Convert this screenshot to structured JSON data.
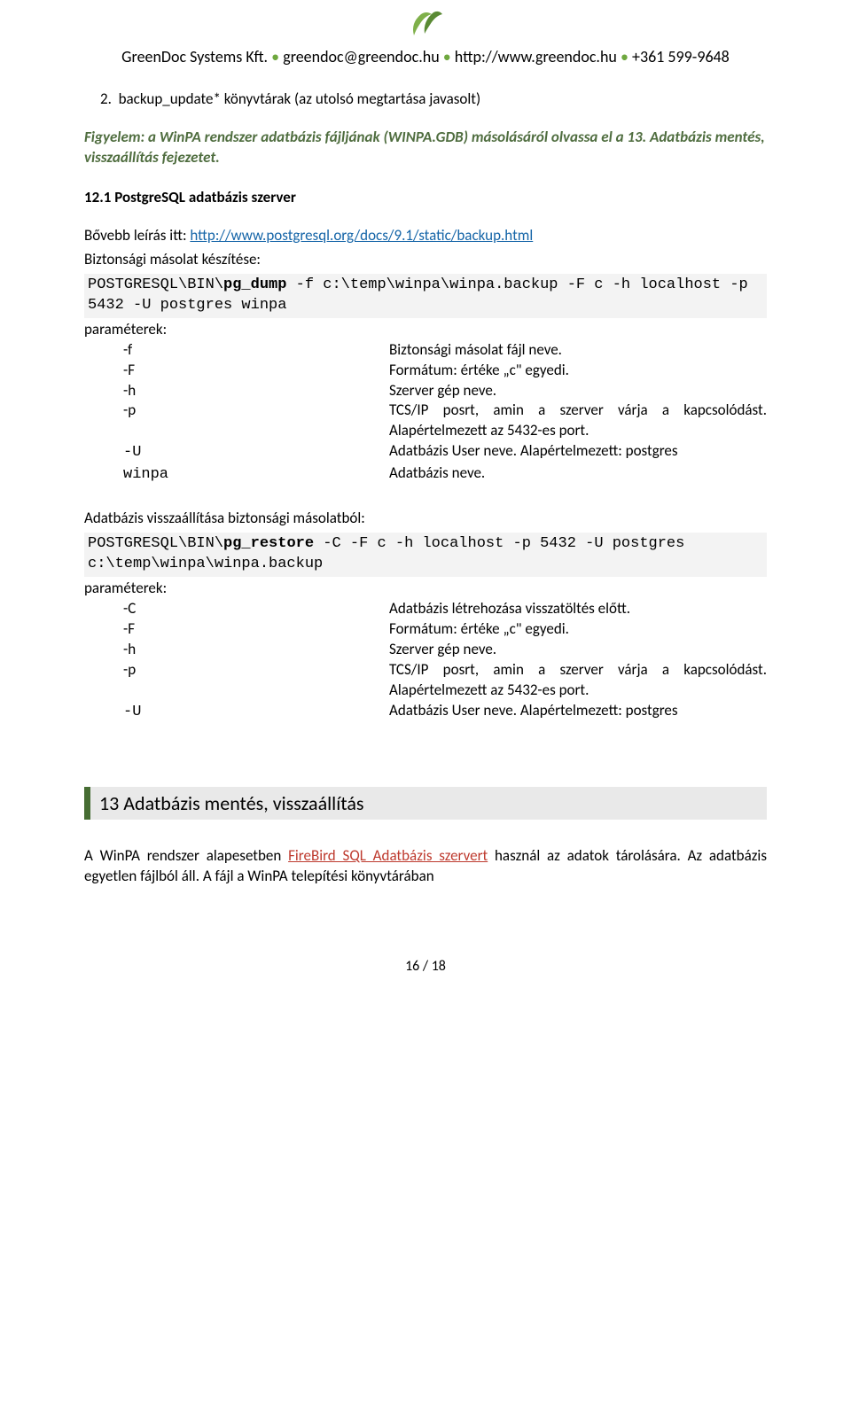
{
  "header": {
    "company": "GreenDoc Systems Kft.",
    "email": "greendoc@greendoc.hu",
    "url": "http://www.greendoc.hu",
    "phone": "+361 599-9648"
  },
  "item2": {
    "num": "2.",
    "text": "backup_update* könyvtárak (az utolsó megtartása javasolt)"
  },
  "notice": "Figyelem: a WinPA rendszer adatbázis fájljának (WINPA.GDB) másolásáról olvassa el a 13. Adatbázis mentés, visszaállítás fejezetet.",
  "subheading": "12.1 PostgreSQL adatbázis szerver",
  "detail_prefix": "Bővebb leírás itt: ",
  "detail_link": "http://www.postgresql.org/docs/9.1/static/backup.html",
  "backup_intro": "Biztonsági másolat készítése:",
  "code1_pre": "POSTGRESQL\\BIN\\",
  "code1_cmd": "pg_dump",
  "code1_post": " -f c:\\temp\\winpa\\winpa.backup -F c -h localhost -p 5432 -U postgres winpa",
  "params_label": "paraméterek:",
  "params1": [
    {
      "key": "-f",
      "mono": false,
      "desc": "Biztonsági másolat fájl neve."
    },
    {
      "key": "-F",
      "mono": false,
      "desc": "Formátum: értéke „c\" egyedi."
    },
    {
      "key": "-h",
      "mono": false,
      "desc": "Szerver gép neve."
    },
    {
      "key": "-p",
      "mono": false,
      "desc": "TCS/IP posrt, amin a szerver várja a kapcsolódást. Alapértelmezett az 5432-es port."
    },
    {
      "key": "-U",
      "mono": true,
      "desc": "Adatbázis User neve. Alapértelmezett: postgres"
    },
    {
      "key": "winpa",
      "mono": true,
      "desc": "Adatbázis neve."
    }
  ],
  "restore_intro": "Adatbázis visszaállítása biztonsági másolatból:",
  "code2_pre": "POSTGRESQL\\BIN\\",
  "code2_cmd": "pg_restore",
  "code2_post": " -C -F c -h localhost -p 5432 -U postgres c:\\temp\\winpa\\winpa.backup",
  "params2": [
    {
      "key": "-C",
      "mono": false,
      "desc": "Adatbázis létrehozása visszatöltés előtt."
    },
    {
      "key": "-F",
      "mono": false,
      "desc": "Formátum: értéke „c\" egyedi."
    },
    {
      "key": "-h",
      "mono": false,
      "desc": "Szerver gép neve."
    },
    {
      "key": "-p",
      "mono": false,
      "desc": "TCS/IP posrt, amin a szerver várja a kapcsolódást. Alapértelmezett az 5432-es port."
    },
    {
      "key": "-U",
      "mono": true,
      "desc": "Adatbázis User neve. Alapértelmezett: postgres"
    }
  ],
  "section13": "13  Adatbázis mentés, visszaállítás",
  "para_pre": "A WinPA rendszer alapesetben ",
  "para_link": "FireBird SQL Adatbázis szervert",
  "para_post": " használ az adatok tárolására. Az adatbázis egyetlen fájlból áll. A fájl a WinPA telepítési könyvtárában",
  "footer": "16 / 18"
}
